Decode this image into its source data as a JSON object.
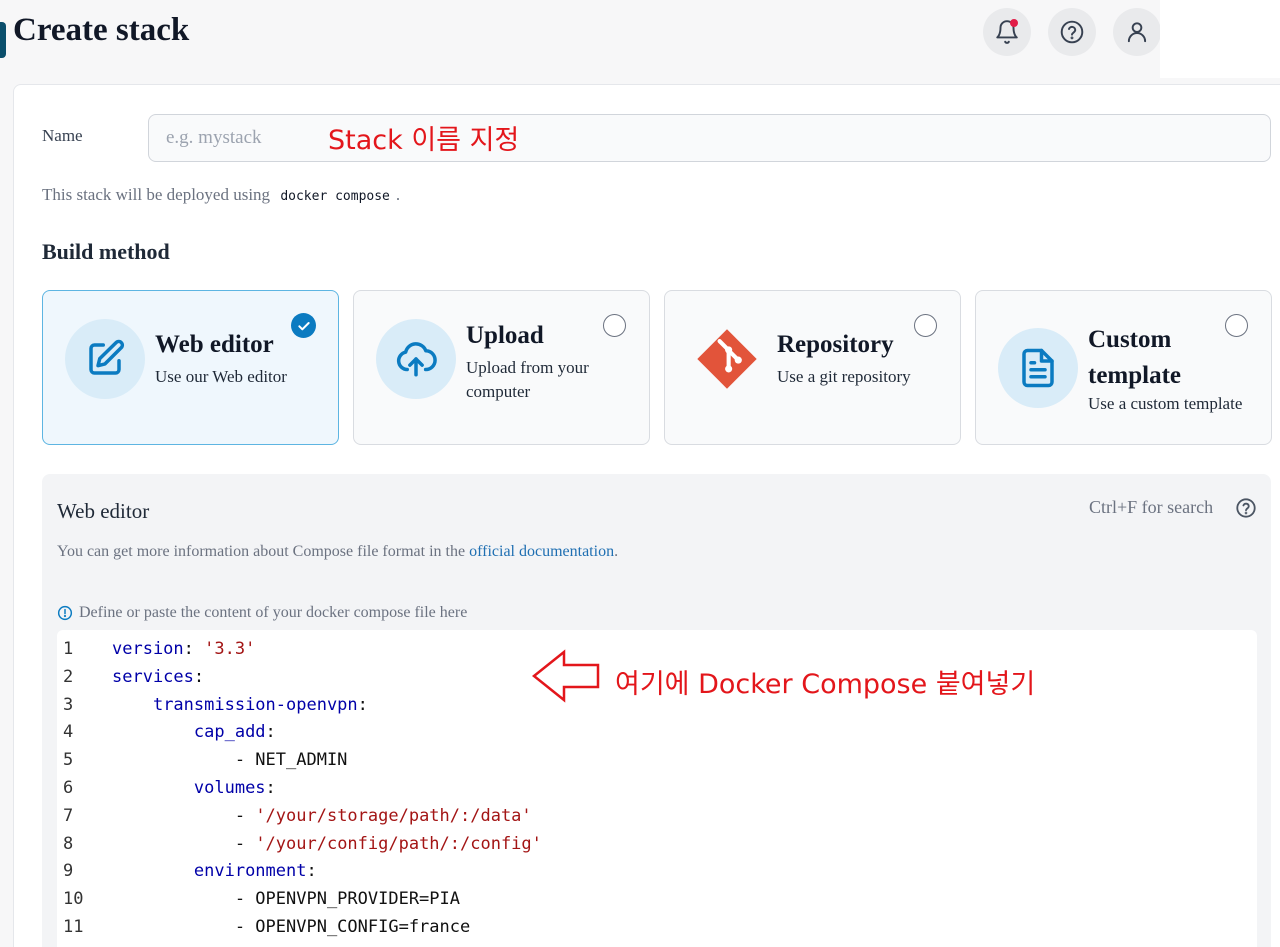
{
  "header": {
    "title": "Create stack",
    "icons": [
      "bell-icon",
      "help-icon",
      "user-icon"
    ]
  },
  "form": {
    "name_label": "Name",
    "name_placeholder": "e.g. mystack",
    "deploy_note_prefix": "This stack will be deployed using",
    "deploy_note_code": "docker compose",
    "deploy_note_suffix": ".",
    "build_method_title": "Build method"
  },
  "build_methods": [
    {
      "title": "Web editor",
      "desc": "Use our Web editor",
      "icon": "edit-icon",
      "selected": true
    },
    {
      "title": "Upload",
      "desc": "Upload from your computer",
      "icon": "cloud-upload-icon",
      "selected": false
    },
    {
      "title": "Repository",
      "desc": "Use a git repository",
      "icon": "git-icon",
      "selected": false
    },
    {
      "title": "Custom template",
      "desc": "Use a custom template",
      "icon": "file-text-icon",
      "selected": false
    }
  ],
  "editor": {
    "title": "Web editor",
    "search_hint": "Ctrl+F for search",
    "info_prefix": "You can get more information about Compose file format in the",
    "info_link": "official documentation",
    "info_suffix": ".",
    "define_note": "Define or paste the content of your docker compose file here",
    "lines": [
      {
        "n": "1",
        "indent": "",
        "key": "version",
        "sep": ": ",
        "str": "'3.3'",
        "text": ""
      },
      {
        "n": "2",
        "indent": "",
        "key": "services",
        "sep": ":",
        "str": "",
        "text": ""
      },
      {
        "n": "3",
        "indent": "    ",
        "key": "transmission-openvpn",
        "sep": ":",
        "str": "",
        "text": ""
      },
      {
        "n": "4",
        "indent": "        ",
        "key": "cap_add",
        "sep": ":",
        "str": "",
        "text": ""
      },
      {
        "n": "5",
        "indent": "            ",
        "key": "",
        "sep": "",
        "str": "",
        "text": "- NET_ADMIN"
      },
      {
        "n": "6",
        "indent": "        ",
        "key": "volumes",
        "sep": ":",
        "str": "",
        "text": ""
      },
      {
        "n": "7",
        "indent": "            ",
        "key": "",
        "sep": "- ",
        "str": "'/your/storage/path/:/data'",
        "text": ""
      },
      {
        "n": "8",
        "indent": "            ",
        "key": "",
        "sep": "- ",
        "str": "'/your/config/path/:/config'",
        "text": ""
      },
      {
        "n": "9",
        "indent": "        ",
        "key": "environment",
        "sep": ":",
        "str": "",
        "text": ""
      },
      {
        "n": "10",
        "indent": "            ",
        "key": "",
        "sep": "",
        "str": "",
        "text": "- OPENVPN_PROVIDER=PIA"
      },
      {
        "n": "11",
        "indent": "            ",
        "key": "",
        "sep": "",
        "str": "",
        "text": "- OPENVPN_CONFIG=france"
      }
    ]
  },
  "annotations": {
    "name_annotation": "Stack 이름 지정",
    "compose_annotation": "여기에 Docker Compose 붙여넣기",
    "color": "#e3161b"
  },
  "colors": {
    "accent": "#0b7bc1",
    "selected_border": "#5db5e2",
    "link": "#1f6fb2",
    "yaml_key": "#0000a8",
    "yaml_string": "#a31515"
  }
}
